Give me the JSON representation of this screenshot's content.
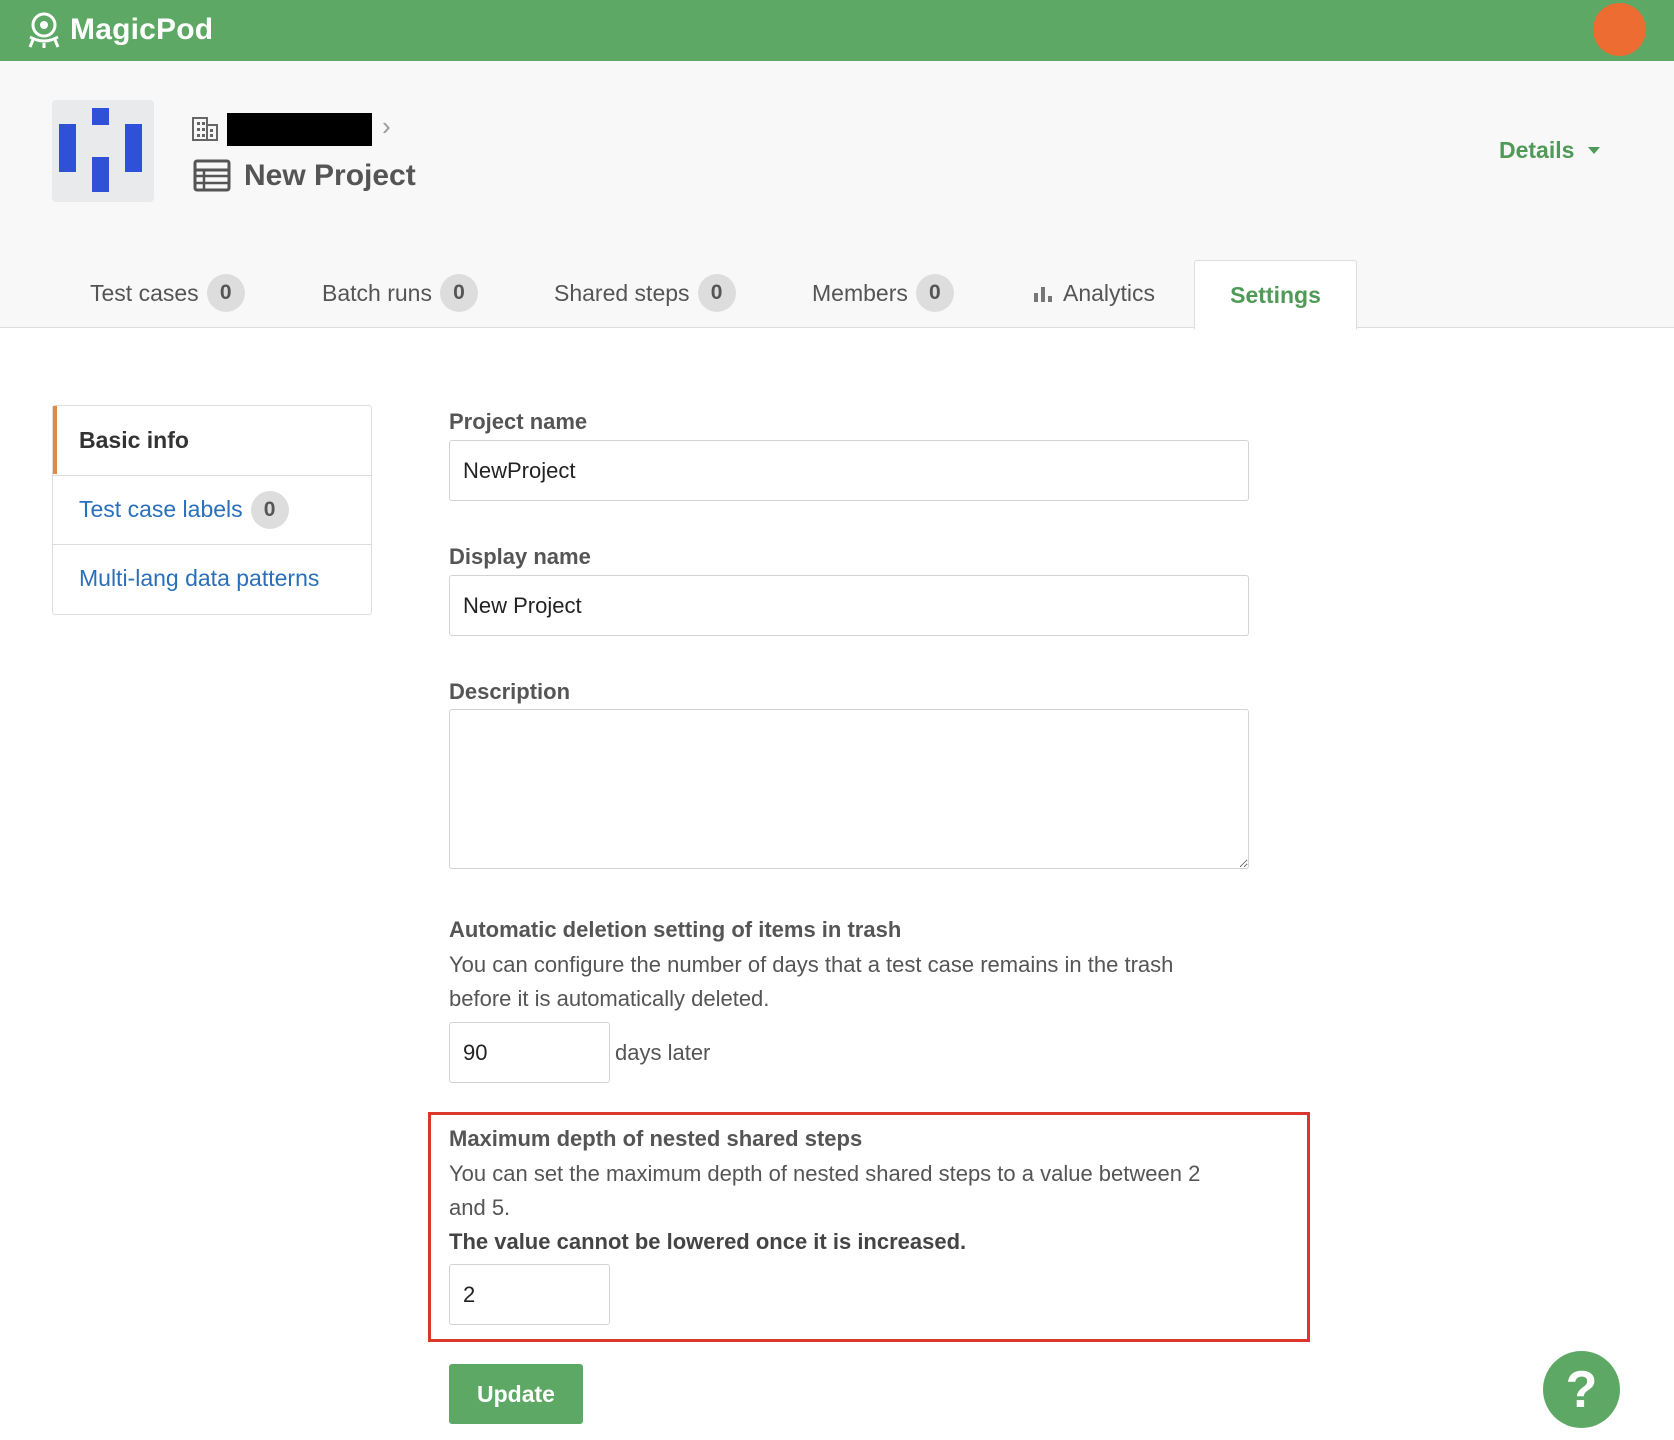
{
  "app": {
    "name": "MagicPod",
    "accent": "#5ea865",
    "avatar_color": "#ec6c31"
  },
  "project": {
    "title": "New Project"
  },
  "header": {
    "details_label": "Details"
  },
  "tabs": [
    {
      "label": "Test cases",
      "count": "0"
    },
    {
      "label": "Batch runs",
      "count": "0"
    },
    {
      "label": "Shared steps",
      "count": "0"
    },
    {
      "label": "Members",
      "count": "0"
    },
    {
      "label": "Analytics",
      "icon": "bar-chart-icon"
    },
    {
      "label": "Settings",
      "active": true
    }
  ],
  "sidebar": {
    "items": [
      {
        "label": "Basic info",
        "active": true
      },
      {
        "label": "Test case labels",
        "count": "0"
      },
      {
        "label": "Multi-lang data patterns"
      }
    ]
  },
  "form": {
    "project_name": {
      "label": "Project name",
      "value": "NewProject"
    },
    "display_name": {
      "label": "Display name",
      "value": "New Project"
    },
    "description": {
      "label": "Description",
      "value": ""
    },
    "trash": {
      "label": "Automatic deletion setting of items in trash",
      "help_line1": "You can configure the number of days that a test case remains in the trash",
      "help_line2": "before it is automatically deleted.",
      "value": "90",
      "suffix": "days later"
    },
    "nested_depth": {
      "label": "Maximum depth of nested shared steps",
      "help_line1": "You can set the maximum depth of nested shared steps to a value between 2",
      "help_line2": "and 5.",
      "warning": "The value cannot be lowered once it is increased.",
      "value": "2"
    },
    "update_label": "Update"
  },
  "help_button": {
    "label": "?"
  }
}
